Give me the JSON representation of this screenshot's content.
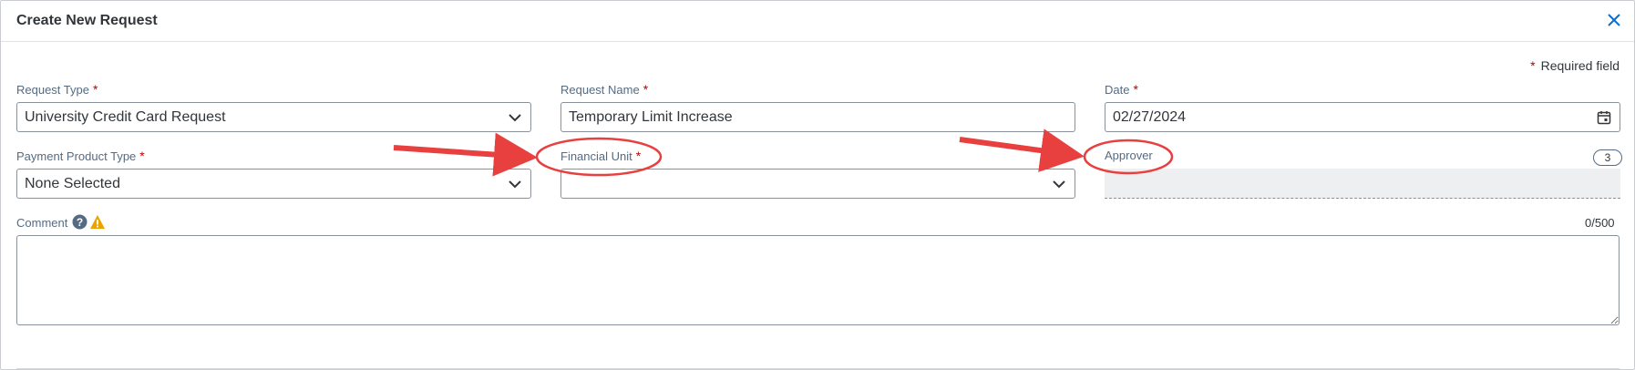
{
  "dialog": {
    "title": "Create New Request",
    "close_icon": "close-icon"
  },
  "required_note": {
    "star": "*",
    "text": "Required field"
  },
  "fields": {
    "request_type": {
      "label": "Request Type",
      "value": "University Credit Card Request",
      "icon": "chevron-down-icon"
    },
    "request_name": {
      "label": "Request Name",
      "value": "Temporary Limit Increase"
    },
    "date": {
      "label": "Date",
      "value": "02/27/2024",
      "icon": "calendar-icon"
    },
    "payment_product_type": {
      "label": "Payment Product Type",
      "value": "None Selected",
      "icon": "chevron-down-icon"
    },
    "financial_unit": {
      "label": "Financial Unit",
      "value": "",
      "icon": "chevron-down-icon"
    },
    "approver": {
      "label": "Approver",
      "value": "",
      "count": "3"
    },
    "comment": {
      "label": "Comment",
      "value": "",
      "counter": "0/500",
      "help_icon": "help-icon",
      "warning_icon": "warning-icon"
    }
  },
  "star": "*",
  "colors": {
    "accent": "#0a6ed1",
    "required": "#bb0000",
    "annotation": "#e8403f"
  }
}
